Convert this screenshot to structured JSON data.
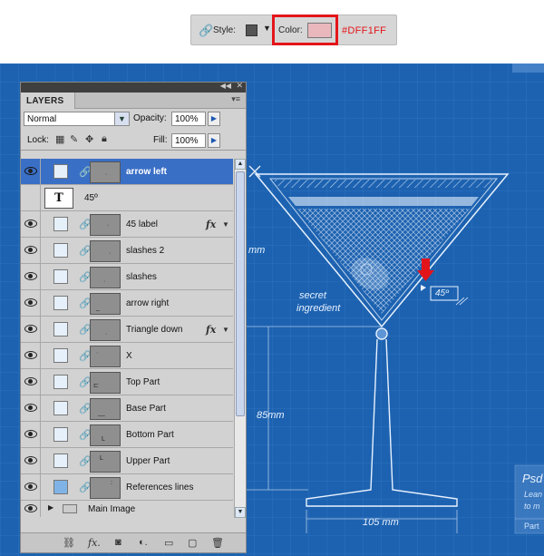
{
  "style_bar": {
    "style_label": "Style:",
    "color_label": "Color:",
    "color_hex_label": "#DFF1FF",
    "style_swatch_color": "#555555",
    "color_swatch_color": "#e9b8bd",
    "highlight_color": "#e3151a"
  },
  "layers_panel": {
    "tab_title": "LAYERS",
    "blend_mode": "Normal",
    "opacity_label": "Opacity:",
    "opacity_value": "100%",
    "lock_label": "Lock:",
    "fill_label": "Fill:",
    "fill_value": "100%",
    "layers": [
      {
        "name": "arrow left",
        "selected": true,
        "fx": false
      },
      {
        "name": "45º",
        "type": "text"
      },
      {
        "name": "45 label",
        "fx": true
      },
      {
        "name": "slashes 2",
        "fx": false
      },
      {
        "name": "slashes",
        "fx": false
      },
      {
        "name": "arrow right",
        "fx": false
      },
      {
        "name": "Triangle down",
        "fx": true
      },
      {
        "name": "X",
        "fx": false
      },
      {
        "name": "Top Part",
        "fx": false
      },
      {
        "name": "Base Part",
        "fx": false
      },
      {
        "name": "Bottom Part",
        "fx": false
      },
      {
        "name": "Upper Part",
        "fx": false
      },
      {
        "name": "References lines",
        "fx": false
      }
    ],
    "group_name": "Main Image"
  },
  "blueprint": {
    "bg_color": "#1d62b0",
    "grid_color": "#3b7fca",
    "line_color": "#e8f2ff",
    "dimension_mm_partial": "mm",
    "dimension_85": "85mm",
    "dimension_105": "105 mm",
    "angle_label": "45º",
    "annotation_line1": "secret",
    "annotation_line2": "ingredient",
    "corner_title": "Psd",
    "corner_text1": "Lean",
    "corner_text2": "to m",
    "corner_text3": "Part"
  }
}
